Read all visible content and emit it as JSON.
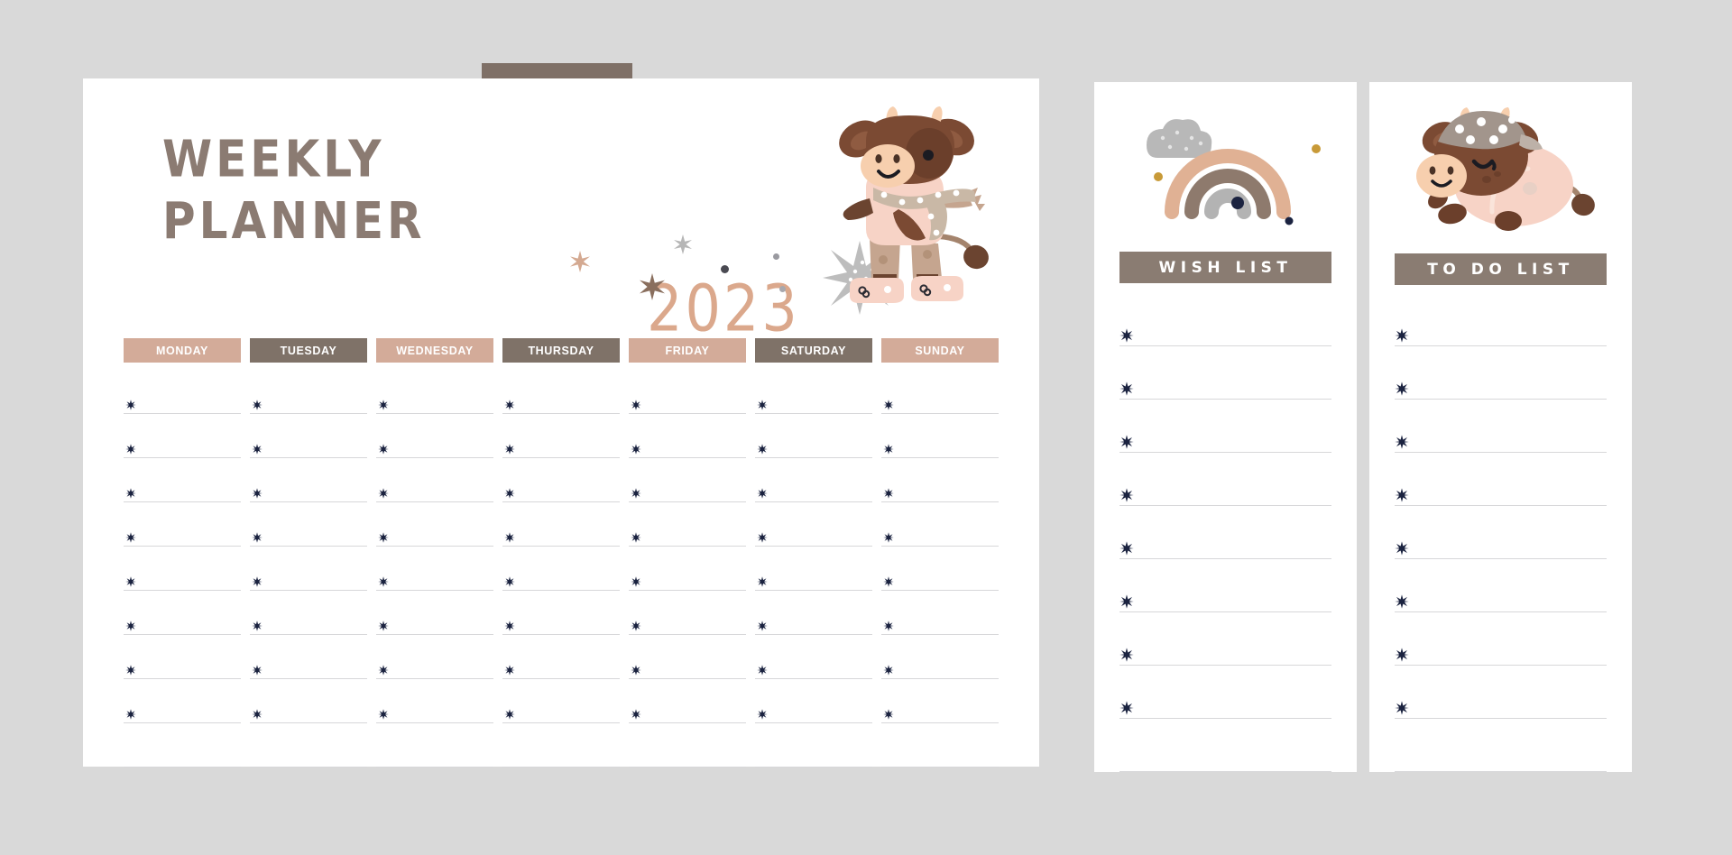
{
  "canvas": {
    "background_color": "#d9d9d9",
    "page_color": "#ffffff"
  },
  "planner": {
    "tab": {
      "name": "planner-tab",
      "top_color": "#7f7067",
      "bottom_color": "#9b8e85"
    },
    "title_line1": "WEEKLY",
    "title_line2": "PLANNER",
    "title_color": "#8b7b72",
    "year": "2023",
    "year_color": "#dba88c",
    "mascot": "walking-cow-illustration",
    "decorations": [
      {
        "name": "star-small-tan",
        "color": "#d4a991",
        "points": 6
      },
      {
        "name": "star-small-gray",
        "color": "#b6b6b6",
        "points": 5
      },
      {
        "name": "star-brown",
        "color": "#8a6f5e",
        "points": 6
      },
      {
        "name": "star-large-gray",
        "color": "#bdbdbd",
        "points": 7
      },
      {
        "name": "dot-dark",
        "color": "#4a4a52"
      },
      {
        "name": "dot-gray",
        "color": "#b0b0b0"
      }
    ],
    "days": [
      {
        "label": "MONDAY",
        "tone": "a",
        "color": "#d3ab99"
      },
      {
        "label": "TUESDAY",
        "tone": "b",
        "color": "#7f7268"
      },
      {
        "label": "WEDNESDAY",
        "tone": "a",
        "color": "#d3ab99"
      },
      {
        "label": "THURSDAY",
        "tone": "b",
        "color": "#7f7268"
      },
      {
        "label": "FRIDAY",
        "tone": "a",
        "color": "#d3ab99"
      },
      {
        "label": "SATURDAY",
        "tone": "b",
        "color": "#7f7268"
      },
      {
        "label": "SUNDAY",
        "tone": "a",
        "color": "#d3ab99"
      }
    ],
    "rows_with_bullet": 8,
    "trailing_blank_rows": 1,
    "bullet_glyph": "six-point-asterisk",
    "bullet_color": "#1b2340",
    "rule_color": "#d7d7d9"
  },
  "wish_list": {
    "banner_label": "WISH LIST",
    "banner_color": "#8a7c72",
    "art": "rainbow-with-cloud-illustration",
    "art_colors": {
      "arc_outer": "#e0b194",
      "arc_middle": "#8e7a6d",
      "arc_inner": "#b3b3b3",
      "cloud": "#b8b8b8",
      "dot_mustard": "#c89a38",
      "dot_navy": "#1b2340"
    },
    "rows_with_bullet": 8,
    "trailing_blank_rows": 1
  },
  "todo_list": {
    "banner_label": "TO DO LIST",
    "banner_color": "#8a7c72",
    "art": "sleeping-cow-illustration",
    "art_colors": {
      "head": "#7b4a33",
      "body": "#f6d2c6",
      "bandana": "#a2958c",
      "muzzle": "#f7cfae",
      "hoof": "#6b3f2b"
    },
    "rows_with_bullet": 8,
    "trailing_blank_rows": 1
  }
}
